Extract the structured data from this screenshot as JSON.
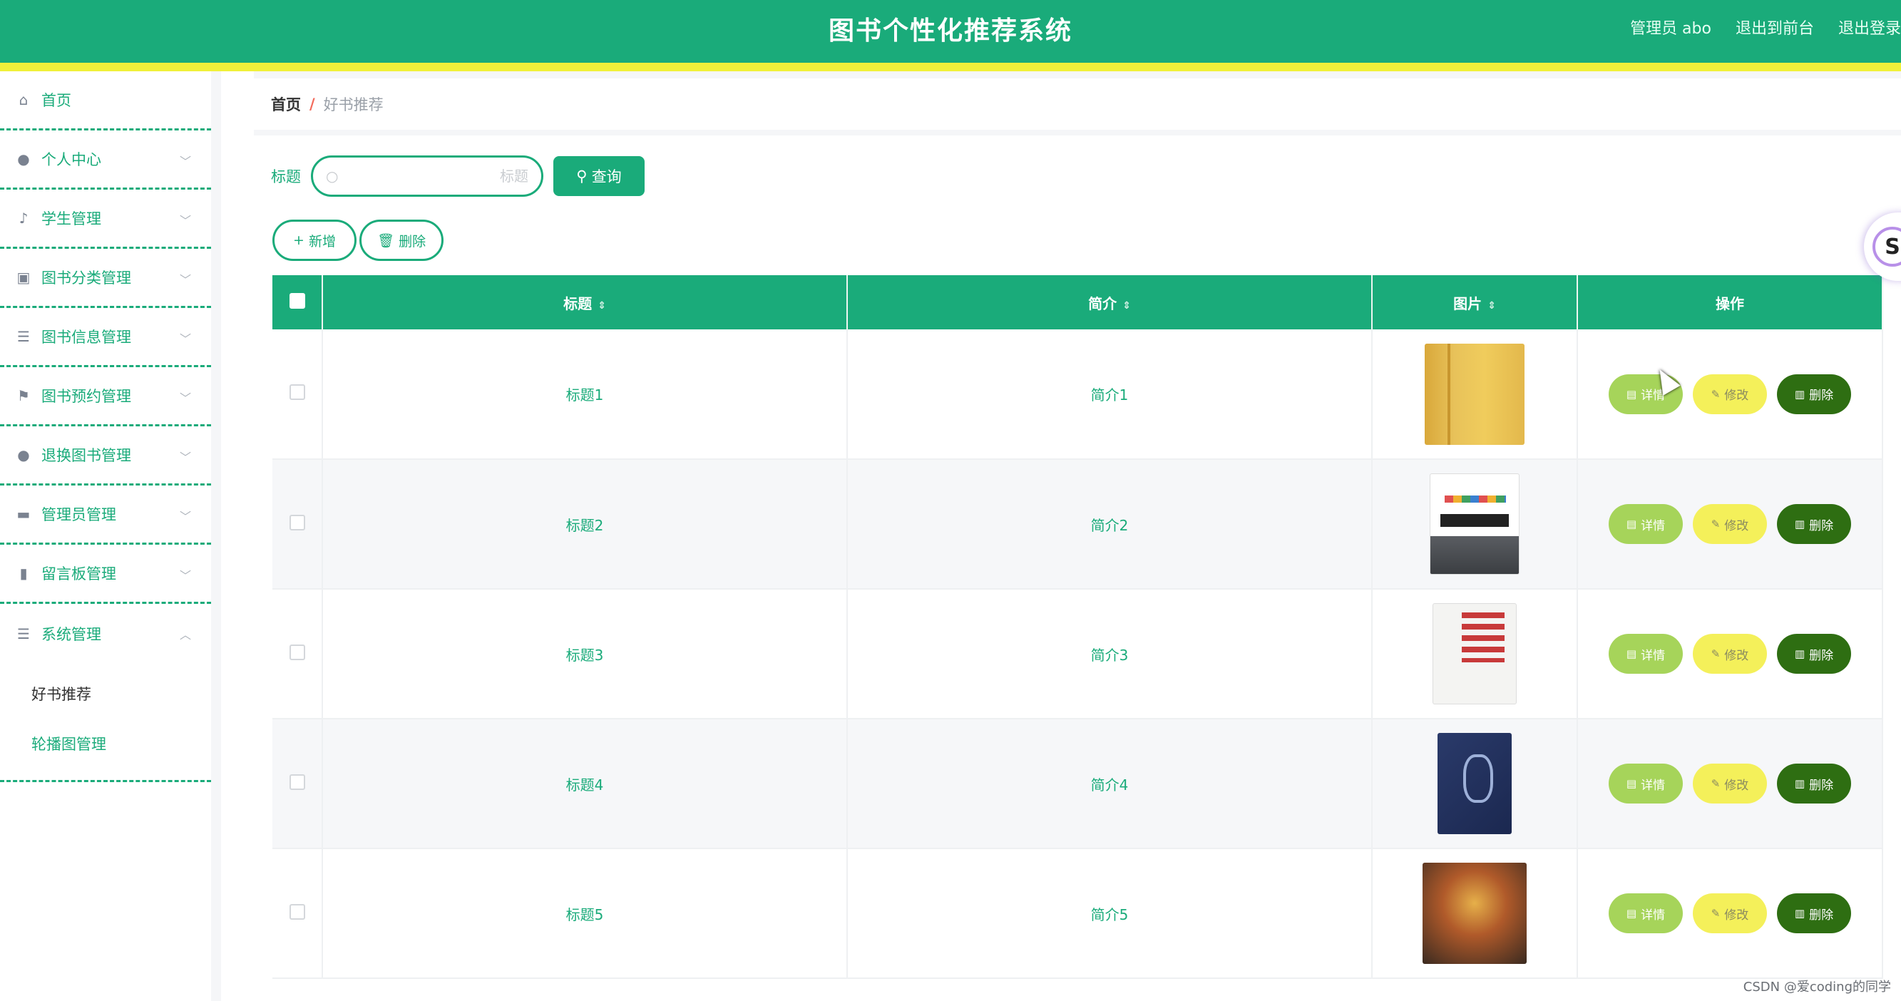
{
  "header": {
    "title": "图书个性化推荐系统",
    "admin_label": "管理员 abo",
    "back_front": "退出到前台",
    "logout": "退出登录"
  },
  "sidebar": {
    "items": [
      {
        "label": "首页",
        "icon": "home-icon",
        "has_chevron": false
      },
      {
        "label": "个人中心",
        "icon": "user-icon",
        "has_chevron": true
      },
      {
        "label": "学生管理",
        "icon": "microphone-icon",
        "has_chevron": true
      },
      {
        "label": "图书分类管理",
        "icon": "chart-icon",
        "has_chevron": true
      },
      {
        "label": "图书信息管理",
        "icon": "list-icon",
        "has_chevron": true
      },
      {
        "label": "图书预约管理",
        "icon": "flag-icon",
        "has_chevron": true
      },
      {
        "label": "退换图书管理",
        "icon": "user-icon",
        "has_chevron": true
      },
      {
        "label": "管理员管理",
        "icon": "monitor-icon",
        "has_chevron": true
      },
      {
        "label": "留言板管理",
        "icon": "bar-chart-icon",
        "has_chevron": true
      },
      {
        "label": "系统管理",
        "icon": "menu-icon",
        "has_chevron": true,
        "expanded": true
      }
    ],
    "submenu": [
      {
        "label": "好书推荐",
        "active": true
      },
      {
        "label": "轮播图管理",
        "active": false
      }
    ]
  },
  "breadcrumb": {
    "home": "首页",
    "separator": "/",
    "current": "好书推荐"
  },
  "search": {
    "label": "标题",
    "placeholder": "标题",
    "button": "查询"
  },
  "actions": {
    "add": "新增",
    "delete": "删除"
  },
  "table": {
    "columns": [
      "标题",
      "简介",
      "图片",
      "操作"
    ],
    "rows": [
      {
        "title": "标题1",
        "intro": "简介1",
        "cover": "golden-book-cover"
      },
      {
        "title": "标题2",
        "intro": "简介2",
        "cover": "white-leadership-book-cover"
      },
      {
        "title": "标题3",
        "intro": "简介3",
        "cover": "white-red-text-book-cover"
      },
      {
        "title": "标题4",
        "intro": "简介4",
        "cover": "dark-blue-book-cover"
      },
      {
        "title": "标题5",
        "intro": "简介5",
        "cover": "illustrated-character-book-cover"
      }
    ],
    "row_actions": {
      "detail": "详情",
      "edit": "修改",
      "delete": "删除"
    }
  },
  "watermark": "CSDN @爱coding的同学",
  "colors": {
    "primary": "#1aab7a",
    "accent_bar": "#f0f03a",
    "detail_button": "#a6d45a",
    "edit_button": "#f4f05a",
    "delete_button": "#2e6e12"
  }
}
